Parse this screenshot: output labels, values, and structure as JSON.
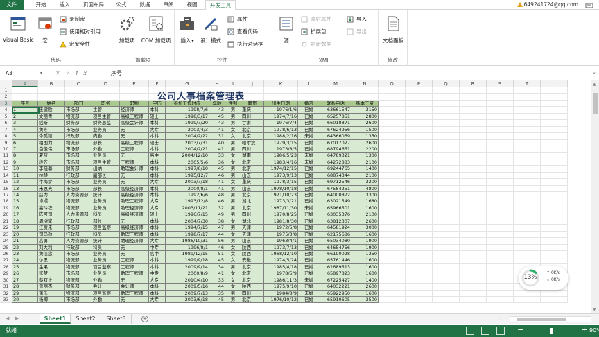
{
  "tabs": [
    {
      "label": "文件"
    },
    {
      "label": "开始"
    },
    {
      "label": "插入"
    },
    {
      "label": "页面布局"
    },
    {
      "label": "公式"
    },
    {
      "label": "数据"
    },
    {
      "label": "审阅"
    },
    {
      "label": "视图"
    },
    {
      "label": "开发工具"
    }
  ],
  "account": "649241724@qq.com",
  "ribbon": {
    "code": {
      "label": "代码",
      "vb": "Visual Basic",
      "macro": "宏",
      "record": "录制宏",
      "relative": "使用相对引用",
      "security": "宏安全性"
    },
    "addins": {
      "label": "加载项",
      "addins": "加载项",
      "com": "COM 加载项"
    },
    "controls": {
      "label": "控件",
      "insert": "插入",
      "design": "设计模式",
      "props": "属性",
      "viewcode": "查看代码",
      "dialog": "执行对话框"
    },
    "xml": {
      "label": "XML",
      "source": "源",
      "mapprops": "映射属性",
      "expand": "扩展包",
      "refresh": "刷新数据",
      "import": "导入",
      "export": "导出"
    },
    "modify": {
      "label": "修改",
      "panel": "文档面板"
    }
  },
  "formula": {
    "namebox": "A3",
    "value": "序号",
    "fx": "fx"
  },
  "sheet": {
    "title": "公司人事档案管理表",
    "columns": [
      "A",
      "B",
      "C",
      "D",
      "E",
      "F",
      "G",
      "H",
      "I",
      "J",
      "K",
      "L",
      "M",
      "N",
      "O",
      "P",
      "Q",
      "R",
      "S",
      "T",
      "U"
    ],
    "row_numbers": [
      1,
      2,
      3,
      4,
      5,
      6,
      7,
      8,
      9,
      10,
      11,
      12,
      13,
      14,
      15,
      16,
      17,
      18,
      19,
      20,
      21,
      22,
      23,
      24,
      25,
      26,
      27,
      28,
      29,
      30,
      31,
      32,
      33
    ],
    "headers": [
      "序号",
      "姓名",
      "部门",
      "职务",
      "职称",
      "学历",
      "参加工作时间",
      "年龄",
      "性别",
      "籍贯",
      "出生日期",
      "婚否",
      "联系电话",
      "基本工资"
    ],
    "rows": [
      [
        "1",
        "王健欧",
        "市场部",
        "主管",
        "经济师",
        "本科",
        "1998/7/6",
        "43",
        "男",
        "重庆",
        "1976/1/6",
        "已婚",
        "63661547",
        "3150"
      ],
      [
        "2",
        "文丽青",
        "物流部",
        "项目主管",
        "高级工程师",
        "硕士",
        "1998/3/17",
        "45",
        "男",
        "四川",
        "1974/7/16",
        "已婚",
        "65257851",
        "2800"
      ],
      [
        "3",
        "銭昕",
        "财务部",
        "财务总监",
        "高级会计师",
        "本科",
        "1999/7/20",
        "43",
        "男",
        "甘肃",
        "1976/7/4",
        "已婚",
        "66018871",
        "2600"
      ],
      [
        "4",
        "黄冬",
        "市场部",
        "业务员",
        "无",
        "大专",
        "2003/4/3",
        "41",
        "女",
        "北京",
        "1978/6/13",
        "已婚",
        "67624956",
        "1500"
      ],
      [
        "5",
        "令孤颖",
        "行政部",
        "内勤",
        "无",
        "本科",
        "2004/2/22",
        "31",
        "女",
        "北京",
        "1988/2/16",
        "未婚",
        "64366059",
        "1350"
      ],
      [
        "6",
        "柏国力",
        "物流部",
        "部长",
        "高级工程师",
        "硕士",
        "2003/7/31",
        "40",
        "男",
        "哈尔滨",
        "1979/3/15",
        "已婚",
        "67017027",
        "2600"
      ],
      [
        "7",
        "白俊伟",
        "市场部",
        "外勤",
        "工程师",
        "本科",
        "2004/2/21",
        "41",
        "男",
        "四川",
        "1973/8/5",
        "已婚",
        "68794651",
        "2200"
      ],
      [
        "8",
        "夏蓝",
        "市场部",
        "业务员",
        "无",
        "高中",
        "2004/12/10",
        "33",
        "女",
        "湖南",
        "1986/5/23",
        "未婚",
        "64789321",
        "1300"
      ],
      [
        "9",
        "段齐",
        "市场部",
        "项目主管",
        "工程师",
        "本科",
        "2005/5/6",
        "36",
        "女",
        "北京",
        "1983/4/16",
        "未婚",
        "64272883",
        "2100"
      ],
      [
        "10",
        "李晓暮",
        "财务部",
        "出纳",
        "助理会计师",
        "本科",
        "1997/6/10",
        "45",
        "男",
        "北京",
        "1974/12/15",
        "已婚",
        "69244765",
        "1400"
      ],
      [
        "11",
        "林琴",
        "行政部",
        "副部长",
        "无",
        "本科",
        "1995/12/7",
        "46",
        "男",
        "山东",
        "1973/9/13",
        "已婚",
        "68874344",
        "2100"
      ],
      [
        "12",
        "牛梅梦",
        "市场部",
        "业务员",
        "无",
        "大专",
        "2003/7/18",
        "41",
        "女",
        "重庆",
        "1978/3/15",
        "已婚",
        "69712546",
        "3200"
      ],
      [
        "13",
        "米思亮",
        "市场部",
        "部长",
        "高级经济师",
        "本科",
        "2000/8/1",
        "41",
        "男",
        "山东",
        "1978/10/18",
        "已婚",
        "67584251",
        "4800"
      ],
      [
        "14",
        "赵力",
        "人力资源部",
        "统计",
        "高级经济师",
        "本科",
        "1992/6/6",
        "48",
        "男",
        "北京",
        "1971/10/23",
        "已婚",
        "64000872",
        "3300"
      ],
      [
        "15",
        "卓嬛",
        "物流部",
        "业务员",
        "助理工程师",
        "大专",
        "1993/12/8",
        "46",
        "男",
        "湖北",
        "1973/3/21",
        "已婚",
        "63021549",
        "1680"
      ],
      [
        "16",
        "高玲铁",
        "物流部",
        "业务员",
        "助理经济师",
        "大专",
        "2003/11/21",
        "32",
        "男",
        "北京",
        "1987/11/30",
        "未婚",
        "65966501",
        "1600"
      ],
      [
        "17",
        "陈可司",
        "人力资源部",
        "科员",
        "高级经济师",
        "硕士",
        "1996/7/15",
        "49",
        "男",
        "四川",
        "1970/8/25",
        "已婚",
        "63035376",
        "2100"
      ],
      [
        "18",
        "周树家",
        "行政部",
        "部长",
        "无",
        "本科",
        "2004/7/30",
        "38",
        "女",
        "湖北",
        "1981/8/30",
        "已婚",
        "63812307",
        "2600"
      ],
      [
        "19",
        "江贾未",
        "市场部",
        "项目监察",
        "高级经济师",
        "本科",
        "1994/7/15",
        "47",
        "男",
        "天津",
        "1972/5/8",
        "已婚",
        "64581924",
        "3000"
      ],
      [
        "20",
        "司马勋",
        "行政部",
        "科员",
        "助理工程师",
        "本科",
        "1998/7/17",
        "44",
        "女",
        "天津",
        "1975/3/8",
        "已婚",
        "62175686",
        "1600"
      ],
      [
        "21",
        "高勇",
        "人力资源部",
        "统计",
        "助理经济师",
        "大专",
        "1986/10/31",
        "56",
        "男",
        "山东",
        "1963/4/1",
        "已婚",
        "65034080",
        "1900"
      ],
      [
        "22",
        "刘大利",
        "行政部",
        "科员",
        "无",
        "中专",
        "1996/8/1",
        "46",
        "女",
        "陕西",
        "1973/7/13",
        "已婚",
        "64654756",
        "1900"
      ],
      [
        "23",
        "黄信念",
        "市场部",
        "业务员",
        "无",
        "高中",
        "1989/12/15",
        "51",
        "女",
        "陕西",
        "1968/12/10",
        "已婚",
        "66190028",
        "1350"
      ],
      [
        "24",
        "尔思",
        "物流部",
        "业务员",
        "工程师",
        "本科",
        "1999/9/18",
        "45",
        "女",
        "安徽",
        "1974/5/24",
        "已婚",
        "65761446",
        "1600"
      ],
      [
        "25",
        "金果",
        "物流部",
        "项目监察",
        "工程师",
        "本科",
        "2009/9/14",
        "34",
        "男",
        "北京",
        "1985/4/18",
        "已婚",
        "62689513",
        "1600"
      ],
      [
        "26",
        "张梦",
        "市场部",
        "业务员",
        "助理工程师",
        "中专",
        "2000/8/9",
        "41",
        "女",
        "北京",
        "1978/5/9",
        "已婚",
        "65897823",
        "1600"
      ],
      [
        "27",
        "蔡双上",
        "物流部",
        "外勤",
        "无",
        "大专",
        "2010/4/10",
        "33",
        "女",
        "北京",
        "1986/11/3",
        "未婚",
        "67225427",
        "1400"
      ],
      [
        "28",
        "曾丽杰",
        "财务部",
        "会计",
        "会计师",
        "本科",
        "2009/5/16",
        "44",
        "女",
        "陕西",
        "1975/9/10",
        "已婚",
        "64032221",
        "2600"
      ],
      [
        "29",
        "萧乐",
        "物流部",
        "项目监察",
        "助理工程师",
        "本科",
        "2009/7/13",
        "35",
        "男",
        "四川",
        "1984/8/9",
        "未婚",
        "65922950",
        "1600"
      ],
      [
        "30",
        "杨卿",
        "市场部",
        "外勤",
        "无",
        "大专",
        "2003/6/18",
        "45",
        "男",
        "北京",
        "1976/10/12",
        "已婚",
        "65910605",
        "3500"
      ]
    ]
  },
  "sheet_tabs": [
    {
      "label": "Sheet1"
    },
    {
      "label": "Sheet2"
    },
    {
      "label": "Sheet3"
    }
  ],
  "status": {
    "text": "就绪",
    "zoom": "90%",
    "zoom_minus": "−",
    "zoom_plus": "+"
  },
  "widget": {
    "percent": "13%",
    "up": "0K/s",
    "down": "0K/s",
    "progress": 0.13
  },
  "colors": {
    "excel_green": "#217346",
    "header_fill": "#a9c98f",
    "data_fill": "#d9ead3",
    "title": "#1f3864"
  }
}
